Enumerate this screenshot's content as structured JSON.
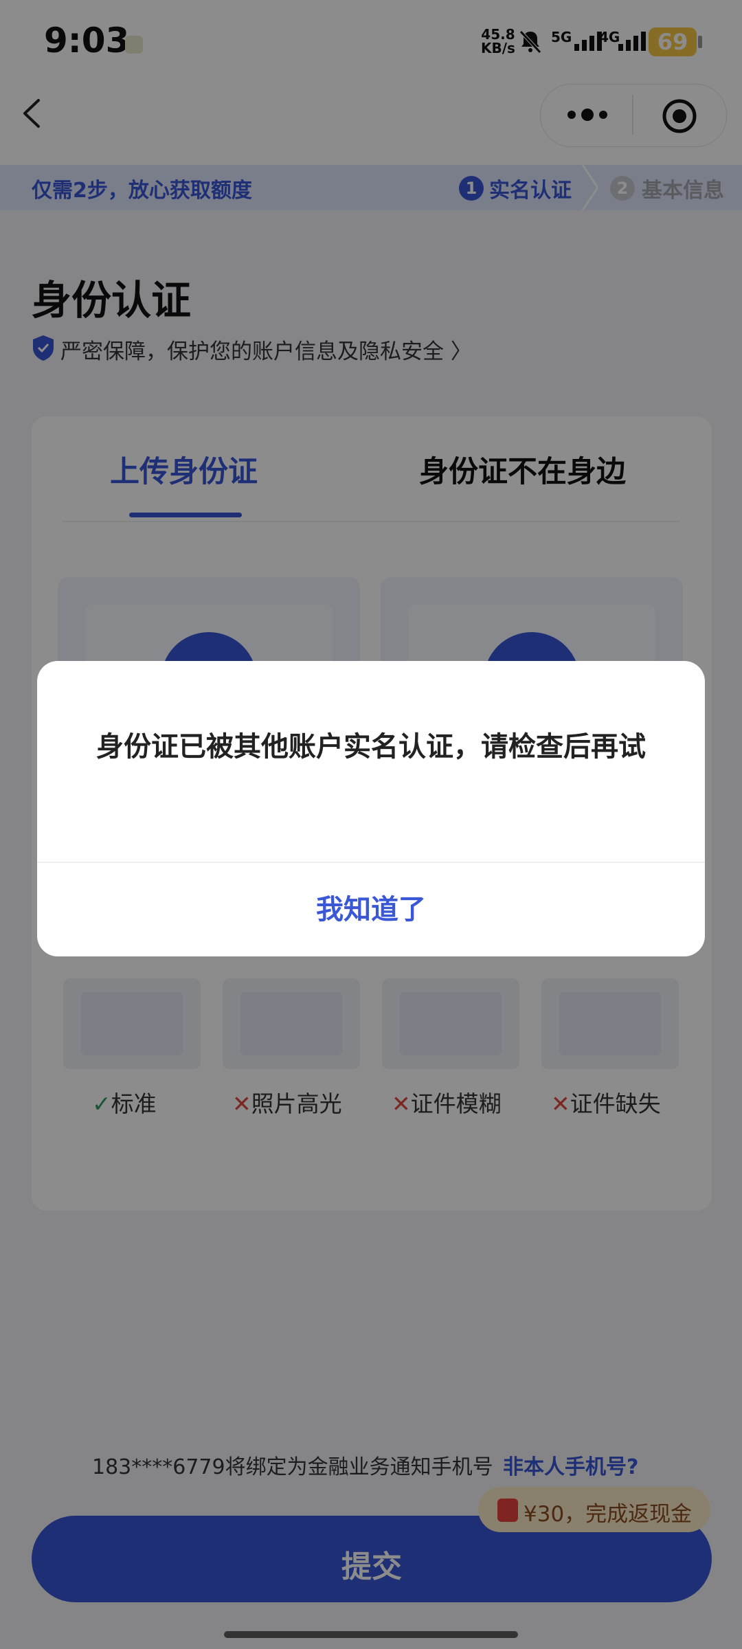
{
  "status_bar": {
    "time": "9:03",
    "net_speed_value": "45.8",
    "net_speed_unit": "KB/s",
    "sim1": "5G",
    "sim2": "4G",
    "battery": "69"
  },
  "progress": {
    "hint": "仅需2步，放心获取额度",
    "step1_num": "1",
    "step1_label": "实名认证",
    "step2_num": "2",
    "step2_label": "基本信息"
  },
  "page": {
    "title": "身份认证",
    "privacy": "严密保障，保护您的账户信息及隐私安全 〉"
  },
  "tabs": {
    "upload": "上传身份证",
    "not_with_me": "身份证不在身边"
  },
  "samples": [
    {
      "mark": "✓",
      "label": "标准",
      "ok": true
    },
    {
      "mark": "✕",
      "label": "照片高光",
      "ok": false
    },
    {
      "mark": "✕",
      "label": "证件模糊",
      "ok": false
    },
    {
      "mark": "✕",
      "label": "证件缺失",
      "ok": false
    }
  ],
  "bottom": {
    "phone_notice": "183****6779将绑定为金融业务通知手机号",
    "not_mine_link": "非本人手机号?",
    "cashback": "¥30，完成返现金",
    "submit": "提交"
  },
  "dialog": {
    "message": "身份证已被其他账户实名认证，请检查后再试",
    "confirm": "我知道了"
  },
  "colors": {
    "accent": "#3a57d6",
    "ok": "#2e9b5f",
    "error": "#e0463f"
  }
}
